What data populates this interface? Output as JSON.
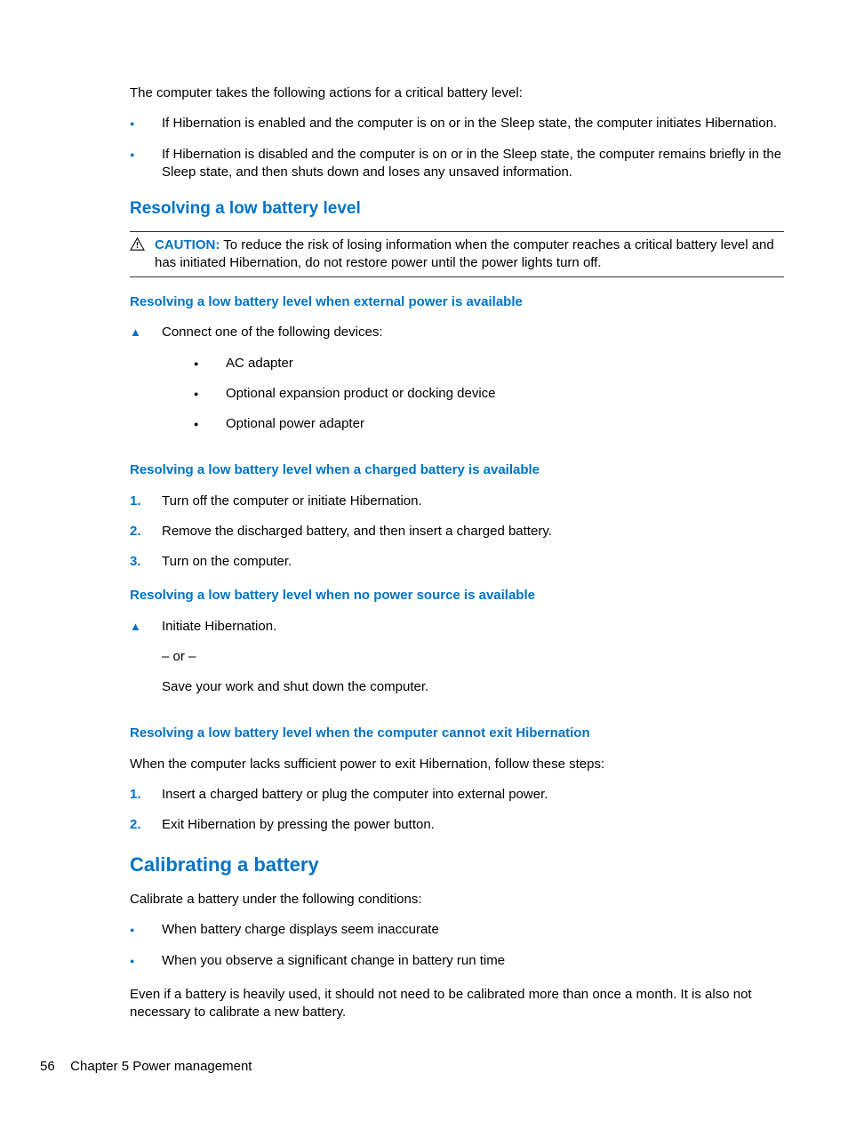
{
  "intro": "The computer takes the following actions for a critical battery level:",
  "actions": [
    "If Hibernation is enabled and the computer is on or in the Sleep state, the computer initiates Hibernation.",
    "If Hibernation is disabled and the computer is on or in the Sleep state, the computer remains briefly in the Sleep state, and then shuts down and loses any unsaved information."
  ],
  "section_resolving": "Resolving a low battery level",
  "caution_label": "CAUTION:",
  "caution_text": "To reduce the risk of losing information when the computer reaches a critical battery level and has initiated Hibernation, do not restore power until the power lights turn off.",
  "subsec_external": "Resolving a low battery level when external power is available",
  "connect_intro": "Connect one of the following devices:",
  "connect_items": [
    "AC adapter",
    "Optional expansion product or docking device",
    "Optional power adapter"
  ],
  "subsec_charged": "Resolving a low battery level when a charged battery is available",
  "charged_steps": [
    "Turn off the computer or initiate Hibernation.",
    "Remove the discharged battery, and then insert a charged battery.",
    "Turn on the computer."
  ],
  "subsec_nopower": "Resolving a low battery level when no power source is available",
  "nopower_line1": "Initiate Hibernation.",
  "nopower_or": "– or –",
  "nopower_line2": "Save your work and shut down the computer.",
  "subsec_cannotexit": "Resolving a low battery level when the computer cannot exit Hibernation",
  "cannotexit_intro": "When the computer lacks sufficient power to exit Hibernation, follow these steps:",
  "cannotexit_steps": [
    "Insert a charged battery or plug the computer into external power.",
    "Exit Hibernation by pressing the power button."
  ],
  "section_calibrate": "Calibrating a battery",
  "calibrate_intro": "Calibrate a battery under the following conditions:",
  "calibrate_items": [
    "When battery charge displays seem inaccurate",
    "When you observe a significant change in battery run time"
  ],
  "calibrate_note": "Even if a battery is heavily used, it should not need to be calibrated more than once a month. It is also not necessary to calibrate a new battery.",
  "footer_page": "56",
  "footer_chapter": "Chapter 5   Power management"
}
